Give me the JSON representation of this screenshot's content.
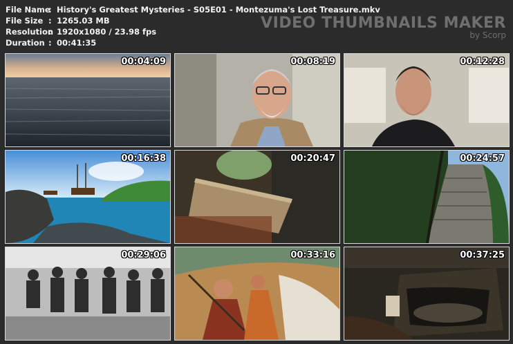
{
  "file_info": [
    {
      "key": "File Name",
      "value": "History's Greatest Mysteries - S05E01 - Montezuma's Lost Treasure.mkv"
    },
    {
      "key": "File Size",
      "value": "1265.03 MB"
    },
    {
      "key": "Resolution",
      "value": "1920x1080 / 23.98 fps"
    },
    {
      "key": "Duration",
      "value": "00:41:35"
    }
  ],
  "separator": ":",
  "brand": {
    "title": "VIDEO THUMBNAILS MAKER",
    "subtitle": "by Scorp"
  },
  "thumbnails": [
    {
      "time": "00:04:09",
      "scene": "ocean-sunset"
    },
    {
      "time": "00:08:19",
      "scene": "man-grey-beard-glasses"
    },
    {
      "time": "00:12:28",
      "scene": "man-dark-beard"
    },
    {
      "time": "00:16:38",
      "scene": "galleon-bay"
    },
    {
      "time": "00:20:47",
      "scene": "hands-book"
    },
    {
      "time": "00:24:57",
      "scene": "jungle-pyramid"
    },
    {
      "time": "00:29:06",
      "scene": "historic-group-photo"
    },
    {
      "time": "00:33:16",
      "scene": "mural-painting"
    },
    {
      "time": "00:37:25",
      "scene": "treasure-chest"
    }
  ]
}
